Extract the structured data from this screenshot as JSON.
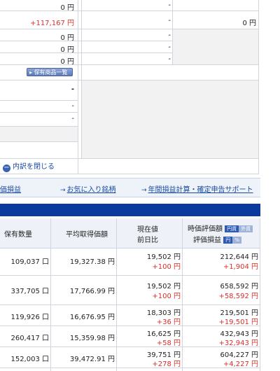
{
  "top_panel": {
    "rows": [
      {
        "value": "0 円",
        "mid": "-",
        "right": "",
        "red": false
      },
      {
        "value": "+117,167 円",
        "mid": "-",
        "right": "0 円",
        "red": true
      },
      {
        "value": "0 円",
        "mid": "-",
        "right": "",
        "red": false
      },
      {
        "value": "0 円",
        "mid": "-",
        "right": "",
        "red": false
      },
      {
        "value": "0 円",
        "mid": "-",
        "right": "",
        "red": false
      }
    ],
    "portfolio_button": "保有商品一覧",
    "lower_marks": [
      "-",
      "-",
      "-"
    ]
  },
  "collapse_label": "内訳を閉じる",
  "links": {
    "profit": "評価損益",
    "favorites": "お気に入り銘柄",
    "annual": "年間損益計算・確定申告サポート"
  },
  "table": {
    "headers": {
      "qty": "保有数量",
      "avg": "平均取得価額",
      "price": "現在値",
      "change": "前日比",
      "valuation": "時価評価額",
      "pl": "評価損益",
      "toggle1_on": "円貨",
      "toggle1_off": "外貨",
      "toggle2_on": "円",
      "toggle2_off": "%"
    },
    "rows": [
      {
        "qty": "109,037 口",
        "avg": "19,327.38 円",
        "price": "19,502 円",
        "change": "+100 円",
        "valuation": "212,644 円",
        "pl": "+1,904 円"
      },
      {
        "qty": "337,705 口",
        "avg": "17,766.99 円",
        "price": "19,502 円",
        "change": "+100 円",
        "valuation": "658,592 円",
        "pl": "+58,592 円"
      },
      {
        "qty": "119,926 口",
        "avg": "16,676.95 円",
        "price": "18,303 円",
        "change": "+36 円",
        "valuation": "219,501 円",
        "pl": "+19,501 円"
      },
      {
        "qty": "260,417 口",
        "avg": "15,359.98 円",
        "price": "16,625 円",
        "change": "+58 円",
        "valuation": "432,943 円",
        "pl": "+32,943 円"
      },
      {
        "qty": "152,003 口",
        "avg": "39,472.91 円",
        "price": "39,751 円",
        "change": "+278 円",
        "valuation": "604,227 円",
        "pl": "+4,227 円"
      }
    ]
  }
}
